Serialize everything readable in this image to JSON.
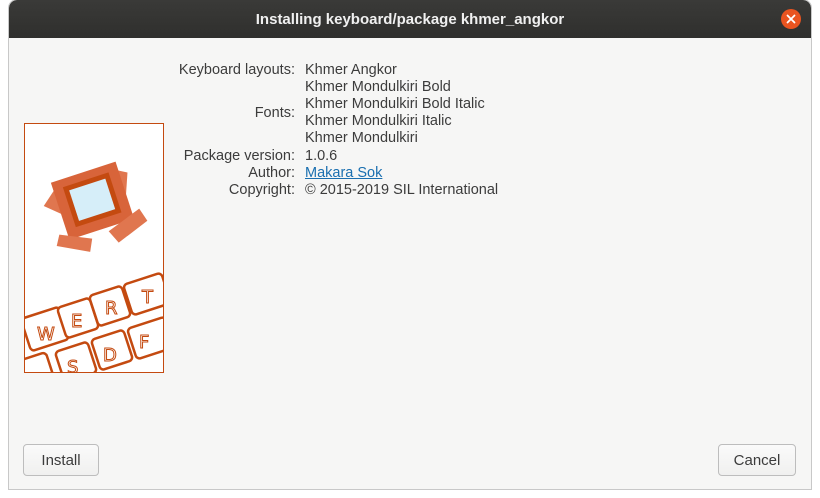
{
  "window": {
    "title": "Installing keyboard/package khmer_angkor"
  },
  "details": {
    "keyboard_layouts_label": "Keyboard layouts:",
    "keyboard_layouts": [
      "Khmer Angkor"
    ],
    "fonts_label": "Fonts:",
    "fonts": [
      "Khmer Mondulkiri Bold",
      "Khmer Mondulkiri Bold Italic",
      "Khmer Mondulkiri Italic",
      "Khmer Mondulkiri"
    ],
    "package_version_label": "Package version:",
    "package_version": "1.0.6",
    "author_label": "Author:",
    "author": "Makara Sok",
    "copyright_label": "Copyright:",
    "copyright": "© 2015-2019 SIL International"
  },
  "logo": {
    "keys": [
      "W",
      "E",
      "R",
      "T",
      "S",
      "D",
      "F"
    ]
  },
  "buttons": {
    "install": "Install",
    "cancel": "Cancel"
  },
  "colors": {
    "accent": "#e95420",
    "logo_orange": "#c44a10",
    "link": "#1a6fb0"
  }
}
